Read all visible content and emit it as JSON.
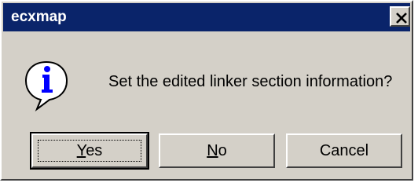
{
  "dialog": {
    "title": "ecxmap",
    "message": "Set the edited linker section information?",
    "icon": "info-icon"
  },
  "buttons": {
    "yes": {
      "mnemonic": "Y",
      "rest": "es"
    },
    "no": {
      "mnemonic": "N",
      "rest": "o"
    },
    "cancel": {
      "label": "Cancel"
    }
  },
  "colors": {
    "titlebar": "#0a246a",
    "face": "#d4d0c8",
    "icon_blue": "#0000ff"
  }
}
